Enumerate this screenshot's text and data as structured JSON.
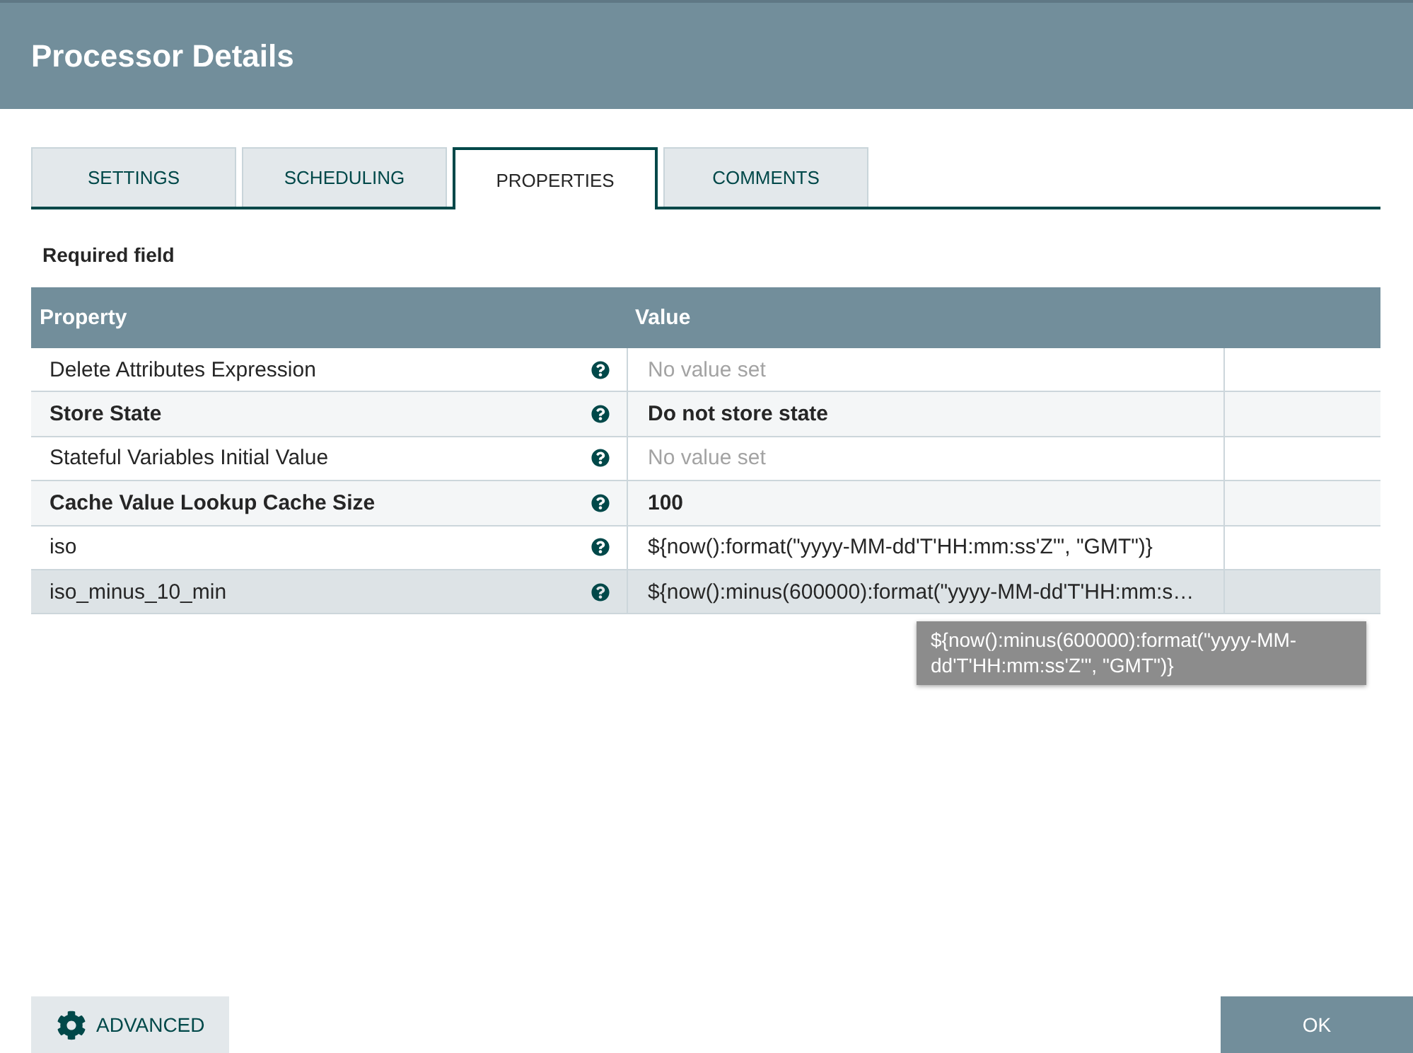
{
  "dialog": {
    "title": "Processor Details"
  },
  "tabs": [
    {
      "label": "SETTINGS",
      "selected": false
    },
    {
      "label": "SCHEDULING",
      "selected": false
    },
    {
      "label": "PROPERTIES",
      "selected": true
    },
    {
      "label": "COMMENTS",
      "selected": false
    }
  ],
  "required_note": "Required field",
  "table": {
    "columns": [
      "Property",
      "Value"
    ],
    "rows": [
      {
        "property": "Delete Attributes Expression",
        "required": false,
        "value": "No value set",
        "empty": true,
        "selected": false
      },
      {
        "property": "Store State",
        "required": true,
        "value": "Do not store state",
        "empty": false,
        "selected": false
      },
      {
        "property": "Stateful Variables Initial Value",
        "required": false,
        "value": "No value set",
        "empty": true,
        "selected": false
      },
      {
        "property": "Cache Value Lookup Cache Size",
        "required": true,
        "value": "100",
        "empty": false,
        "selected": false
      },
      {
        "property": "iso",
        "required": false,
        "value": "${now():format(\"yyyy-MM-dd'T'HH:mm:ss'Z'\", \"GMT\")}",
        "empty": false,
        "selected": false
      },
      {
        "property": "iso_minus_10_min",
        "required": false,
        "value": "${now():minus(600000):format(\"yyyy-MM-dd'T'HH:mm:s…",
        "empty": false,
        "selected": true,
        "tooltip": "${now():minus(600000):format(\"yyyy-MM-dd'T'HH:mm:ss'Z'\", \"GMT\")}"
      }
    ]
  },
  "buttons": [
    {
      "label": "ADVANCED",
      "kind": "advanced"
    },
    {
      "label": "OK",
      "kind": "primary"
    }
  ]
}
